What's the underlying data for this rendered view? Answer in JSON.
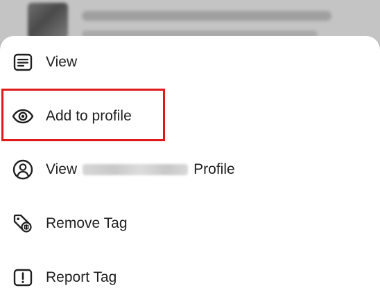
{
  "menu": {
    "items": [
      {
        "label": "View",
        "icon": "document-lines-icon"
      },
      {
        "label": "Add to profile",
        "icon": "eye-icon"
      },
      {
        "label_prefix": "View",
        "label_suffix": "Profile",
        "icon": "person-circle-icon"
      },
      {
        "label": "Remove Tag",
        "icon": "tag-remove-icon"
      },
      {
        "label": "Report Tag",
        "icon": "report-exclamation-icon"
      }
    ]
  },
  "highlight": {
    "color": "#e01919",
    "target": "Add to profile"
  },
  "colors": {
    "text": "#1f1f1f",
    "icon": "#1f1f1f",
    "sheet": "#ffffff",
    "backdrop": "#bdbdbd"
  }
}
